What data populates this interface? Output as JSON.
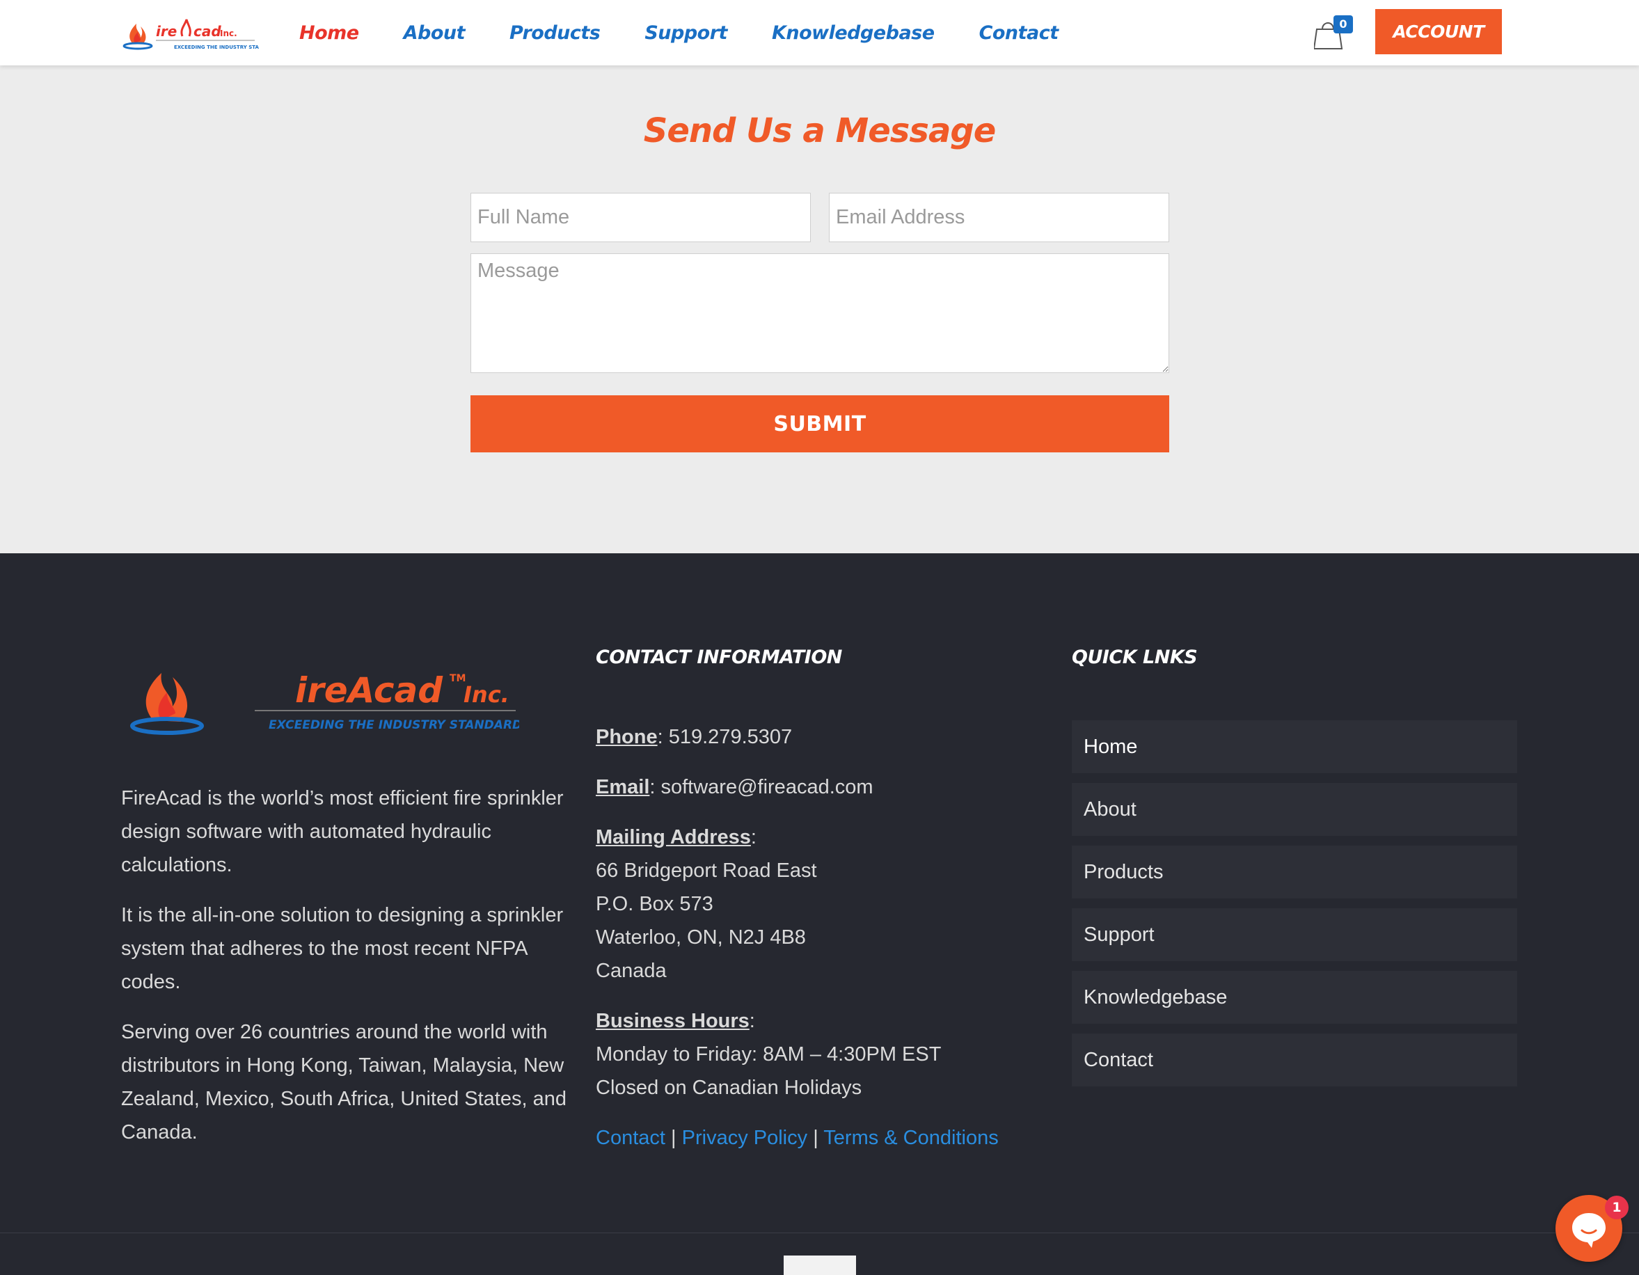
{
  "header": {
    "brand_logo": "fireacad-logo",
    "nav": [
      {
        "label": "Home",
        "active": true
      },
      {
        "label": "About",
        "active": false
      },
      {
        "label": "Products",
        "active": false
      },
      {
        "label": "Support",
        "active": false
      },
      {
        "label": "Knowledgebase",
        "active": false
      },
      {
        "label": "Contact",
        "active": false
      }
    ],
    "cart_icon": "shopping-bag-icon",
    "cart_count": "0",
    "account_label": "ACCOUNT"
  },
  "form": {
    "title": "Send Us a Message",
    "fullname_placeholder": "Full Name",
    "fullname_value": "",
    "email_placeholder": "Email Address",
    "email_value": "",
    "message_placeholder": "Message",
    "message_value": "",
    "submit_label": "SUBMIT"
  },
  "footer": {
    "logo": {
      "wordmark": "ireAcad",
      "tm": "TM",
      "suffix": "Inc.",
      "tagline": "EXCEEDING THE INDUSTRY STANDARD"
    },
    "about_paragraphs": [
      "FireAcad is the world’s most efficient fire sprinkler design software with automated hydraulic calculations.",
      "It is the all-in-one solution to designing a sprinkler system that adheres to the most recent NFPA codes.",
      "Serving over 26 countries around the world with distributors in Hong Kong, Taiwan, Malaysia, New Zealand, Mexico, South Africa, United States, and Canada."
    ],
    "contact_heading": "CONTACT INFORMATION",
    "phone_label": "Phone",
    "phone_value": ": 519.279.5307",
    "email_label": "Email",
    "email_value": ": software@fireacad.com",
    "mailing_label": "Mailing Address",
    "mailing_lines": [
      "66 Bridgeport Road East",
      "P.O. Box 573",
      "Waterloo, ON, N2J 4B8",
      "Canada"
    ],
    "hours_label": "Business Hours",
    "hours_lines": [
      "Monday to Friday: 8AM – 4:30PM EST",
      "Closed on Canadian Holidays"
    ],
    "legal_links": [
      "Contact",
      "Privacy Policy",
      "Terms & Conditions"
    ],
    "separator": "|",
    "colon": ":",
    "quick_heading": "QUICK LNKS",
    "quick_links": [
      "Home",
      "About",
      "Products",
      "Support",
      "Knowledgebase",
      "Contact"
    ]
  },
  "chat": {
    "icon": "chat-bubble-icon",
    "badge": "1"
  },
  "colors": {
    "accent_orange": "#f05a28",
    "nav_blue": "#1a6fc4",
    "nav_active_red": "#e8332a",
    "footer_bg": "#262830",
    "link_blue": "#2a8ee0"
  }
}
